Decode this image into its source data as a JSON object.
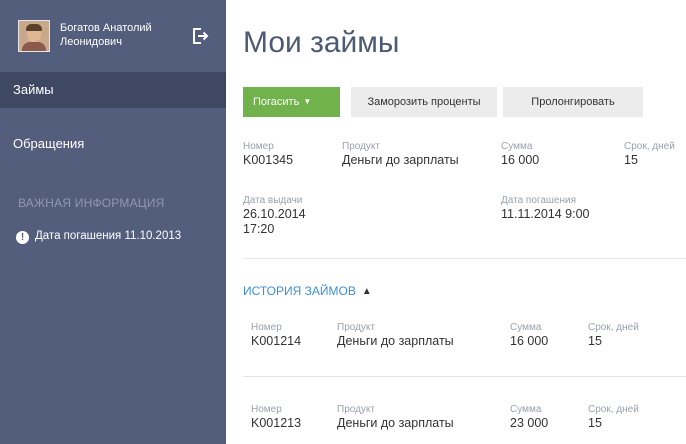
{
  "user": {
    "name": "Богатов Анатолий Леонидович"
  },
  "nav": {
    "loans": "Займы",
    "requests": "Обращения"
  },
  "info": {
    "section_title": "ВАЖНАЯ ИНФОРМАЦИЯ",
    "due_notice": "Дата погашения 11.10.2013"
  },
  "page": {
    "title": "Мои займы"
  },
  "toolbar": {
    "pay": "Погасить",
    "freeze": "Заморозить проценты",
    "prolong": "Пролонгировать"
  },
  "current_loan": {
    "number_label": "Номер",
    "number": "K001345",
    "product_label": "Продукт",
    "product": "Деньги до зарплаты",
    "amount_label": "Сумма",
    "amount": "16 000",
    "term_label": "Срок, дней",
    "term": "15",
    "issue_label": "Дата выдачи",
    "issue_date": "26.10.2014",
    "issue_time": "17:20",
    "due_label": "Дата погашения",
    "due": "11.11.2014 9:00"
  },
  "history": {
    "title": "ИСТОРИЯ ЗАЙМОВ",
    "rows": [
      {
        "number_label": "Номер",
        "number": "K001214",
        "product_label": "Продукт",
        "product": "Деньги до зарплаты",
        "amount_label": "Сумма",
        "amount": "16 000",
        "term_label": "Срок, дней",
        "term": "15"
      },
      {
        "number_label": "Номер",
        "number": "K001213",
        "product_label": "Продукт",
        "product": "Деньги до зарплаты",
        "amount_label": "Сумма",
        "amount": "23 000",
        "term_label": "Срок, дней",
        "term": "15"
      }
    ]
  },
  "colors": {
    "sidebar": "#535e7c",
    "sidebar_active": "#3f4863",
    "accent_green": "#72b24d",
    "link_blue": "#3d8ed6"
  }
}
